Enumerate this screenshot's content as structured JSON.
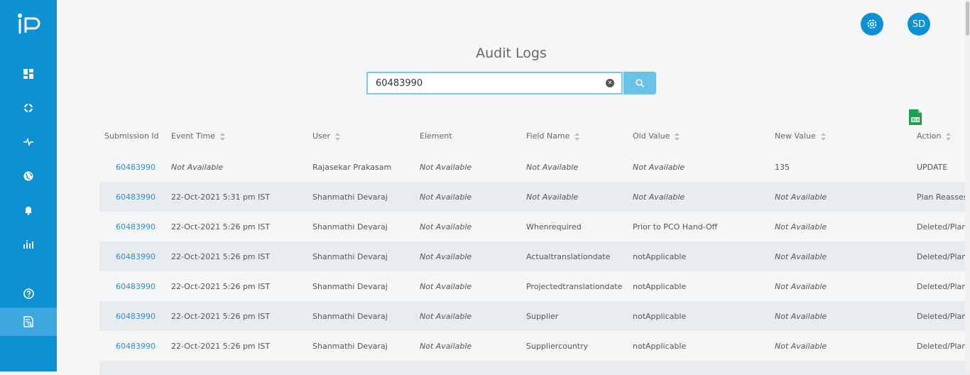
{
  "app": {
    "logo_text": "iP"
  },
  "header": {
    "settings_icon": "gear-icon",
    "avatar_initials": "SD"
  },
  "page": {
    "title": "Audit Logs"
  },
  "search": {
    "value": "60483990",
    "placeholder": ""
  },
  "colors": {
    "primary": "#0e91d2",
    "link": "#2b8ec9",
    "export": "#1f9e4f"
  },
  "sidebar": {
    "items": [
      {
        "icon": "dashboard-icon"
      },
      {
        "icon": "target-icon"
      },
      {
        "icon": "activity-icon"
      },
      {
        "icon": "globe-icon"
      },
      {
        "icon": "bell-icon"
      },
      {
        "icon": "bar-chart-icon"
      },
      {
        "icon": "help-icon"
      },
      {
        "icon": "audit-log-icon",
        "active": true
      }
    ]
  },
  "table": {
    "columns": [
      "Submission Id",
      "Event Time",
      "User",
      "Element",
      "Field Name",
      "Old Value",
      "New Value",
      "Action"
    ],
    "rows": [
      [
        "60483990",
        "Not Available",
        "Rajasekar Prakasam",
        "Not Available",
        "Not Available",
        "Not Available",
        "135",
        "UPDATE"
      ],
      [
        "60483990",
        "22-Oct-2021 5:31 pm IST",
        "Shanmathi Devaraj",
        "Not Available",
        "Not Available",
        "Not Available",
        "Not Available",
        "Plan Reassesse"
      ],
      [
        "60483990",
        "22-Oct-2021 5:26 pm IST",
        "Shanmathi Devaraj",
        "Not Available",
        "Whenrequired",
        "Prior to PCO Hand-Off",
        "Not Available",
        "Deleted/Plan R"
      ],
      [
        "60483990",
        "22-Oct-2021 5:26 pm IST",
        "Shanmathi Devaraj",
        "Not Available",
        "Actualtranslationdate",
        "notApplicable",
        "Not Available",
        "Deleted/Plan R"
      ],
      [
        "60483990",
        "22-Oct-2021 5:26 pm IST",
        "Shanmathi Devaraj",
        "Not Available",
        "Projectedtranslationdate",
        "notApplicable",
        "Not Available",
        "Deleted/Plan R"
      ],
      [
        "60483990",
        "22-Oct-2021 5:26 pm IST",
        "Shanmathi Devaraj",
        "Not Available",
        "Supplier",
        "notApplicable",
        "Not Available",
        "Deleted/Plan R"
      ],
      [
        "60483990",
        "22-Oct-2021 5:26 pm IST",
        "Shanmathi Devaraj",
        "Not Available",
        "Suppliercountry",
        "notApplicable",
        "Not Available",
        "Deleted/Plan R"
      ]
    ]
  }
}
